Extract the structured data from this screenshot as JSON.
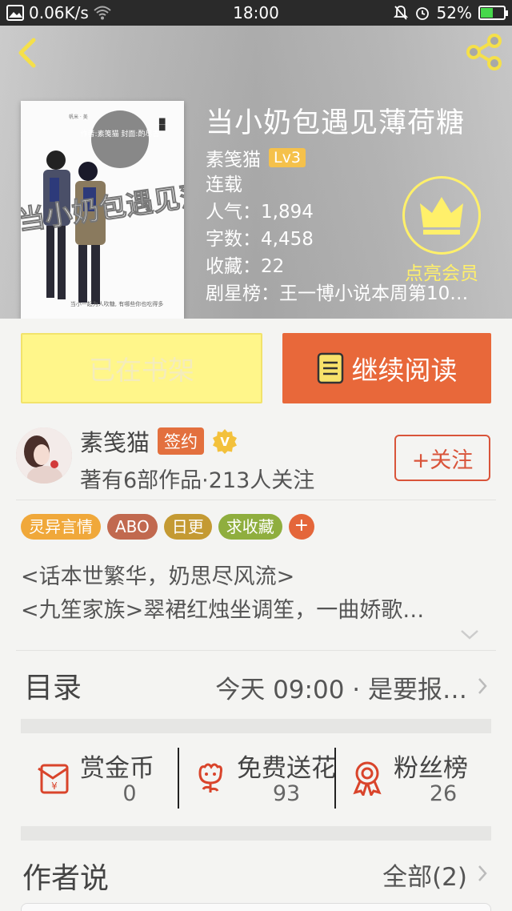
{
  "status_bar": {
    "speed": "0.06K/s",
    "time": "18:00",
    "battery": "52%",
    "battery_level": 0.52
  },
  "book": {
    "title": "当小奶包遇见薄荷糖",
    "author": "素笺猫",
    "level": "Lv3",
    "status": "连载",
    "popularity": "人气：1,894",
    "words": "字数：4,458",
    "favorites": "收藏：22",
    "ranking": "剧星榜：王一博小说本周第10…"
  },
  "vip": {
    "label": "点亮会员",
    "color": "#fff06a"
  },
  "cover": {
    "top_left_text": "帆米 · 美",
    "circle_text": "作者:素笺猫 封面:酌尽古",
    "art_title": "当小奶包遇见薄荷糖",
    "tagline": "当小一起为人吹糖, 有哪些你也吃得多"
  },
  "actions": {
    "shelf_label": "已在书架",
    "read_label": "继续阅读"
  },
  "author_block": {
    "name": "素笺猫",
    "badge": "签约",
    "v_mark": "V",
    "summary": "著有6部作品·213人关注",
    "follow_label": "+关注"
  },
  "tags": [
    {
      "label": "灵异言情",
      "color": "#f0a83a"
    },
    {
      "label": "ABO",
      "color": "#c1694f"
    },
    {
      "label": "日更",
      "color": "#c49a33"
    },
    {
      "label": "求收藏",
      "color": "#8fae3e"
    }
  ],
  "tag_add": "+",
  "description": [
    "<话本世繁华，奶思尽风流>",
    "<九笙家族>翠裙红烛坐调笙，一曲娇歌…"
  ],
  "toc": {
    "label": "目录",
    "latest": "今天 09:00 · 是要报…"
  },
  "stats": [
    {
      "label": "赏金币",
      "value": "0",
      "icon": "red-envelope-icon"
    },
    {
      "label": "免费送花",
      "value": "93",
      "icon": "flower-icon"
    },
    {
      "label": "粉丝榜",
      "value": "26",
      "icon": "medal-icon"
    }
  ],
  "author_says": {
    "label": "作者说",
    "all": "全部(2)"
  },
  "colors": {
    "accent": "#e8683a",
    "shelf": "#fff68a",
    "icon_red": "#d9442b"
  }
}
